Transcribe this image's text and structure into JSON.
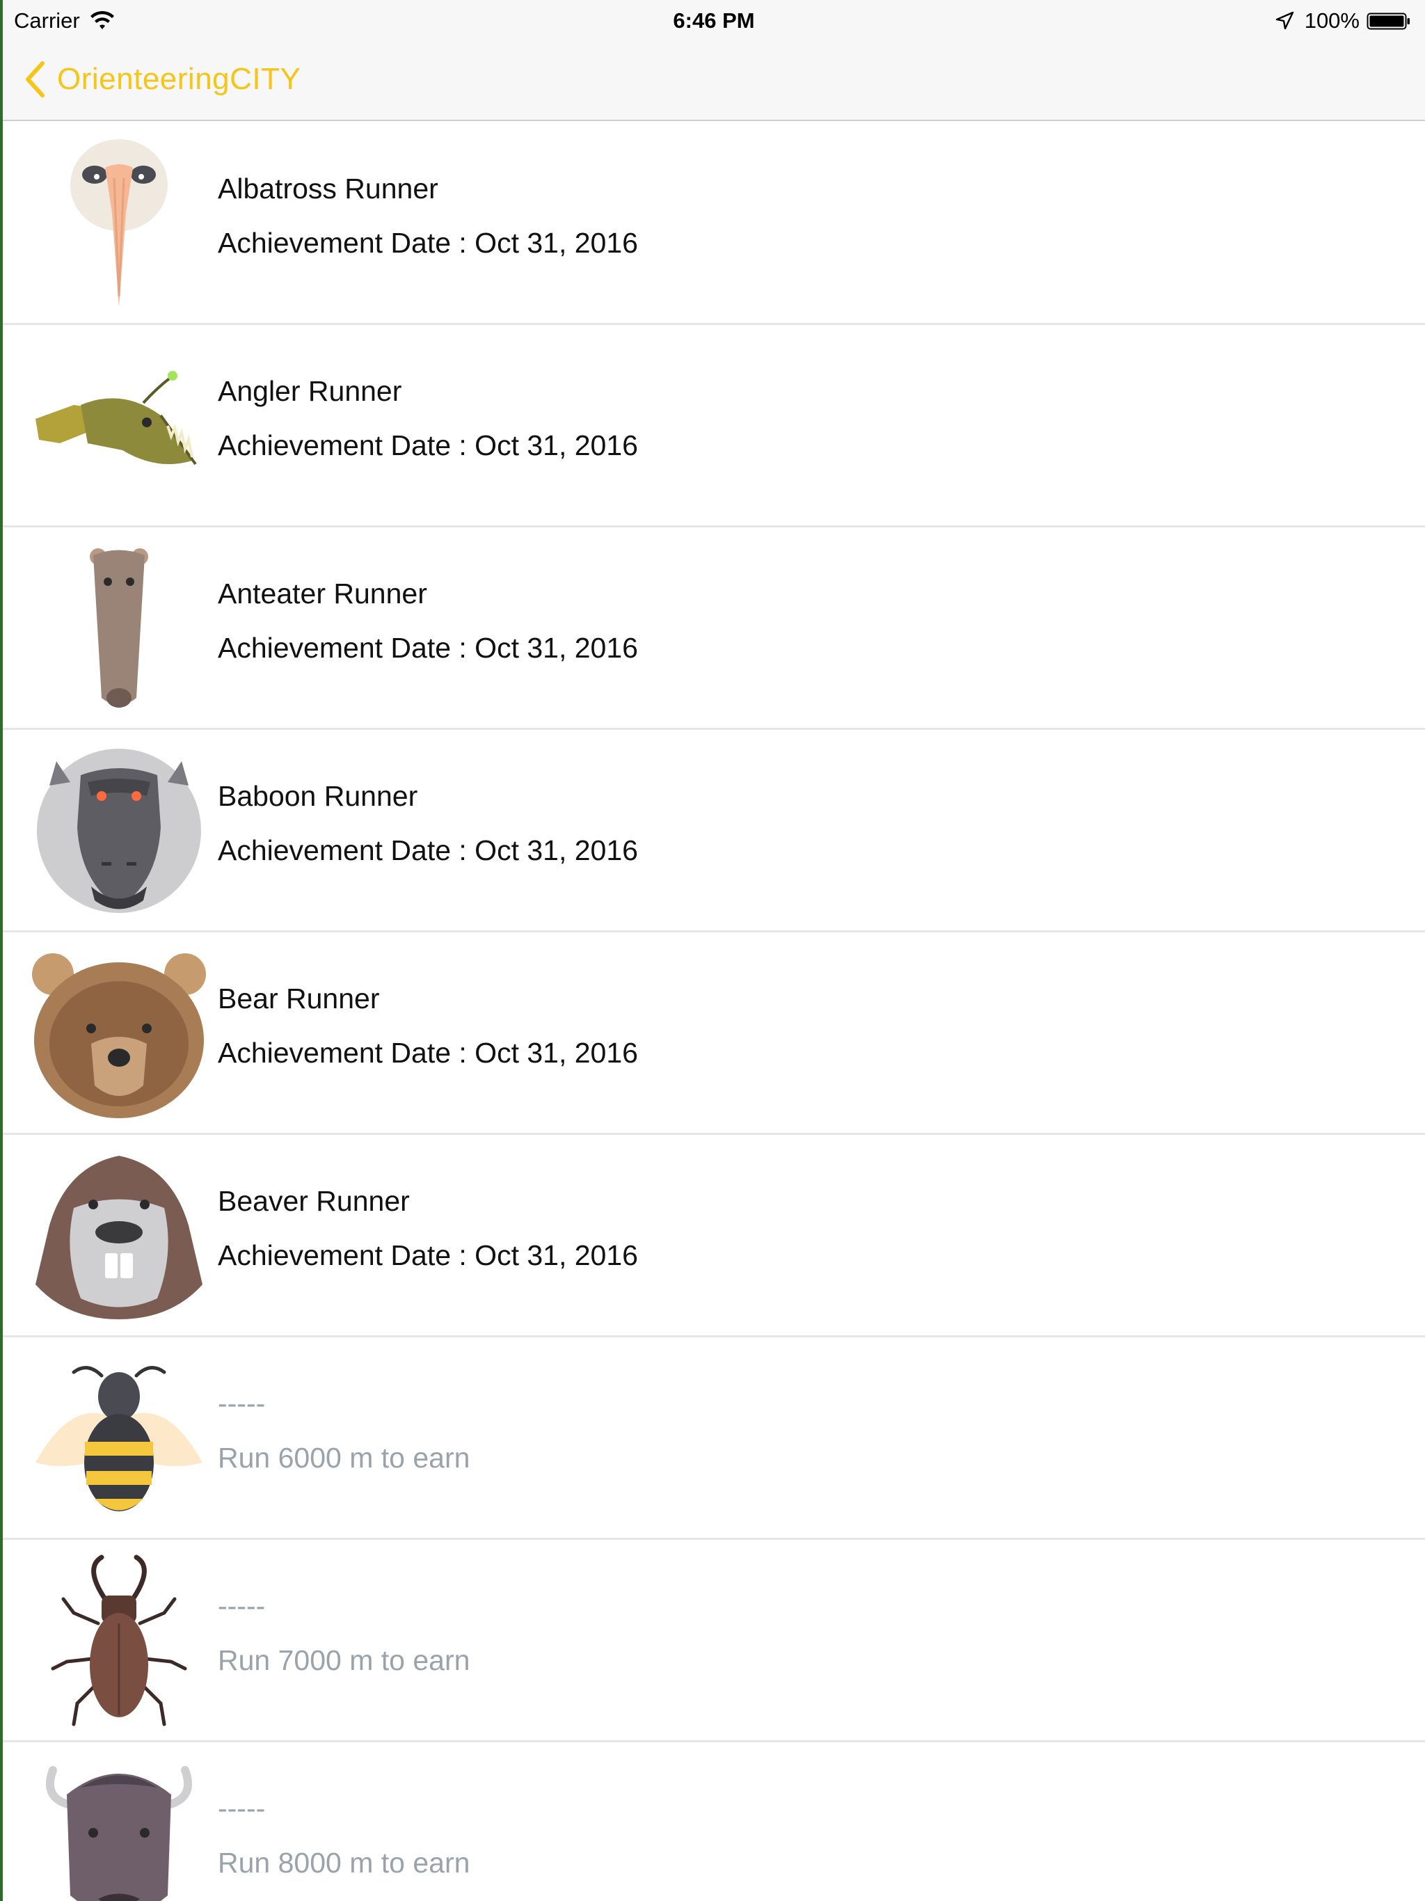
{
  "status_bar": {
    "carrier": "Carrier",
    "time": "6:46 PM",
    "battery": "100%"
  },
  "nav": {
    "back_label": "OrienteeringCITY",
    "accent_color": "#f5c518"
  },
  "rows": [
    {
      "icon": "albatross-icon",
      "title": "Albatross Runner",
      "subtitle": "Achievement Date : Oct 31, 2016",
      "earned": true
    },
    {
      "icon": "angler-icon",
      "title": "Angler Runner",
      "subtitle": "Achievement Date : Oct 31, 2016",
      "earned": true
    },
    {
      "icon": "anteater-icon",
      "title": "Anteater Runner",
      "subtitle": "Achievement Date : Oct 31, 2016",
      "earned": true
    },
    {
      "icon": "baboon-icon",
      "title": "Baboon Runner",
      "subtitle": "Achievement Date : Oct 31, 2016",
      "earned": true
    },
    {
      "icon": "bear-icon",
      "title": "Bear Runner",
      "subtitle": "Achievement Date : Oct 31, 2016",
      "earned": true
    },
    {
      "icon": "beaver-icon",
      "title": "Beaver Runner",
      "subtitle": "Achievement Date : Oct 31, 2016",
      "earned": true
    },
    {
      "icon": "bee-icon",
      "title": "-----",
      "subtitle": "Run 6000 m to earn",
      "earned": false
    },
    {
      "icon": "beetle-icon",
      "title": "-----",
      "subtitle": "Run 7000 m to earn",
      "earned": false
    },
    {
      "icon": "bison-icon",
      "title": "-----",
      "subtitle": "Run 8000 m to earn",
      "earned": false
    }
  ]
}
